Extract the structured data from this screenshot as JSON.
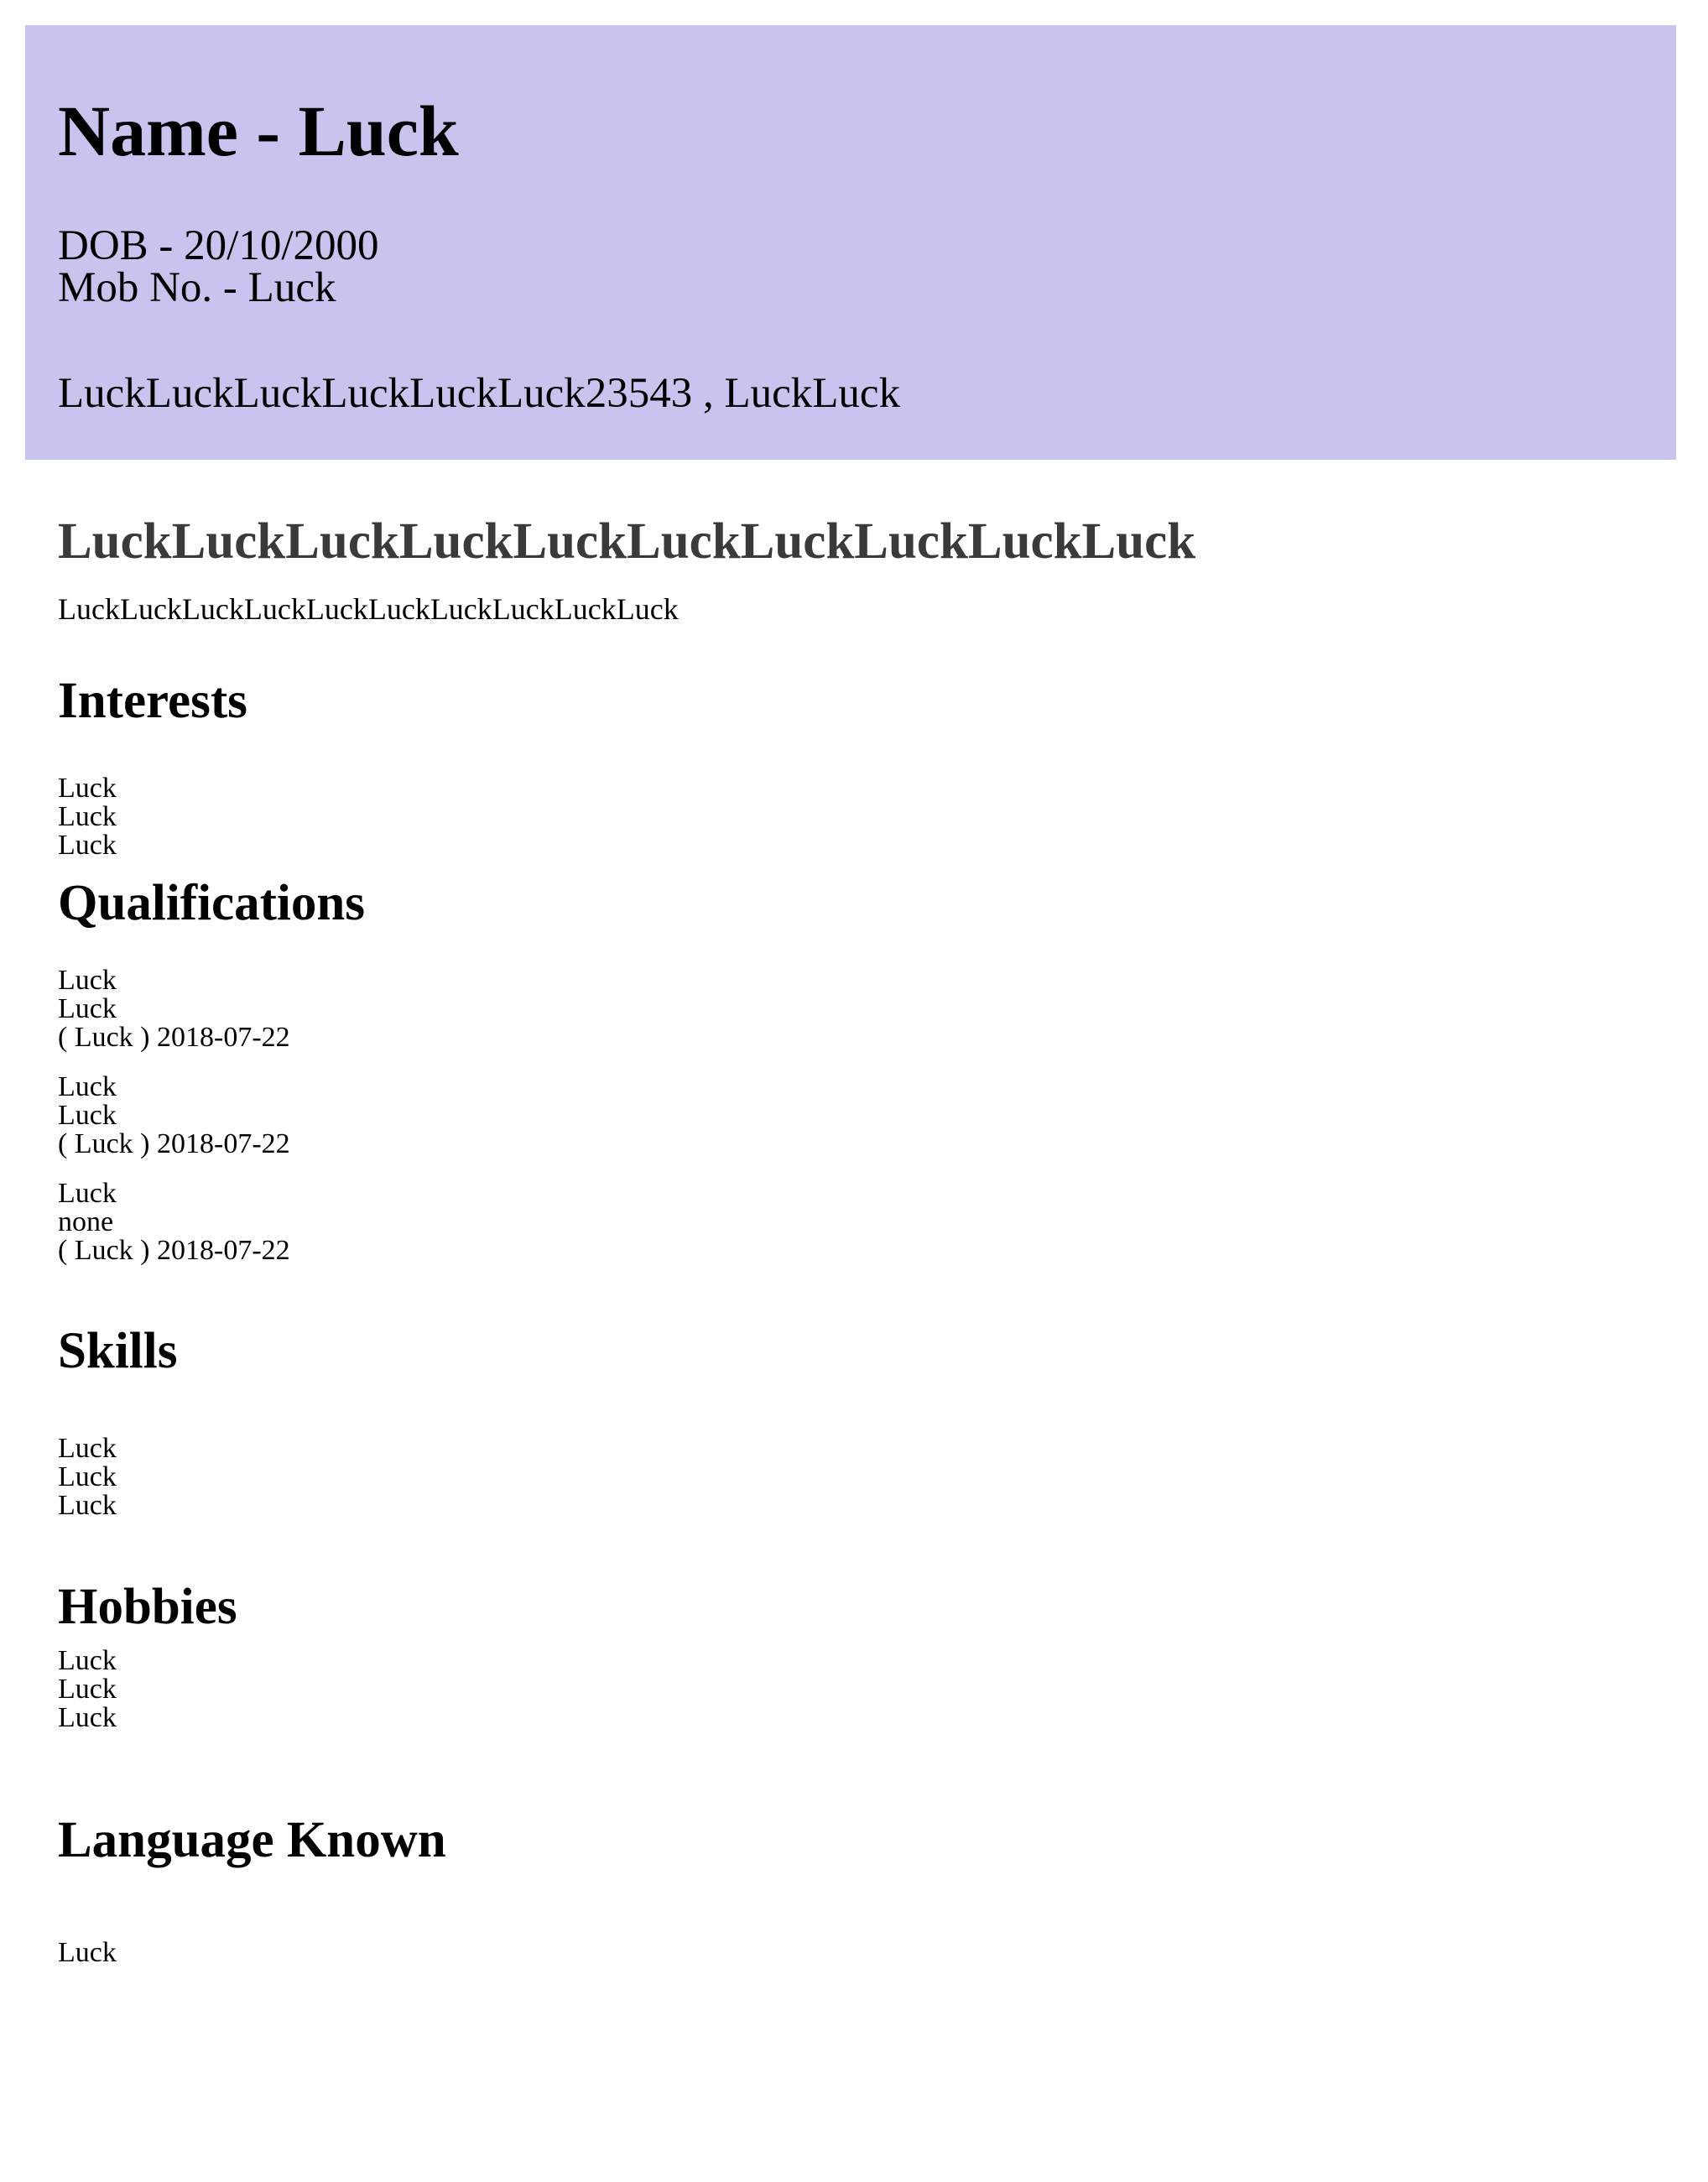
{
  "header": {
    "name": "Name - Luck",
    "dob": "DOB - 20/10/2000",
    "mobile": "Mob No. - Luck",
    "address": "LuckLuckLuckLuckLuckLuck23543 , LuckLuck",
    "background_color": "#c7c5ee"
  },
  "objective": {
    "title": "LuckLuckLuckLuckLuckLuckLuckLuckLuckLuck",
    "text": "LuckLuckLuckLuckLuckLuckLuckLuckLuckLuck"
  },
  "interests": {
    "title": "Interests",
    "items": [
      "Luck",
      "Luck",
      "Luck"
    ]
  },
  "qualifications": {
    "title": "Qualifications",
    "items": [
      {
        "line1": "Luck",
        "line2": "Luck",
        "line3": "( Luck )  2018-07-22"
      },
      {
        "line1": "Luck",
        "line2": "Luck",
        "line3": "( Luck )  2018-07-22"
      },
      {
        "line1": "Luck",
        "line2": "none",
        "line3": "( Luck )  2018-07-22"
      }
    ]
  },
  "skills": {
    "title": "Skills",
    "items": [
      "Luck",
      "Luck",
      "Luck"
    ]
  },
  "hobbies": {
    "title": "Hobbies",
    "items": [
      "Luck",
      "Luck",
      "Luck"
    ]
  },
  "languages": {
    "title": "Language Known",
    "items": [
      "Luck"
    ]
  }
}
